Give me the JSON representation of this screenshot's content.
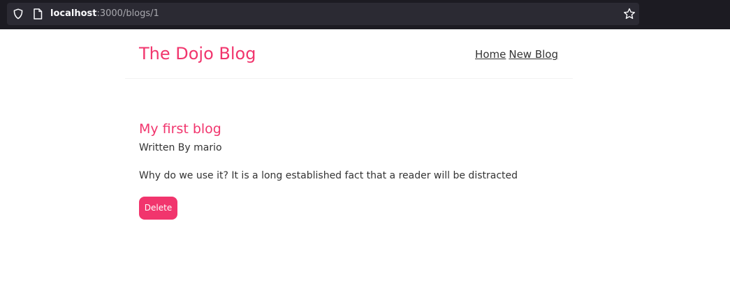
{
  "browser": {
    "url_host": "localhost",
    "url_rest": ":3000/blogs/1"
  },
  "navbar": {
    "title": "The Dojo Blog",
    "links": [
      {
        "label": "Home"
      },
      {
        "label": "New Blog"
      }
    ]
  },
  "blog": {
    "title": "My first blog",
    "author_line": "Written By mario",
    "body": "Why do we use it? It is a long established fact that a reader will be distracted",
    "delete_label": "Delete"
  },
  "colors": {
    "brand_pink": "#f1356d",
    "text": "#333333",
    "browser_chrome": "#1c1b22",
    "url_field": "#2b2a33"
  },
  "icons": {
    "tracking_protection": "shield-icon",
    "page_info": "page-icon",
    "bookmark": "star-icon"
  }
}
